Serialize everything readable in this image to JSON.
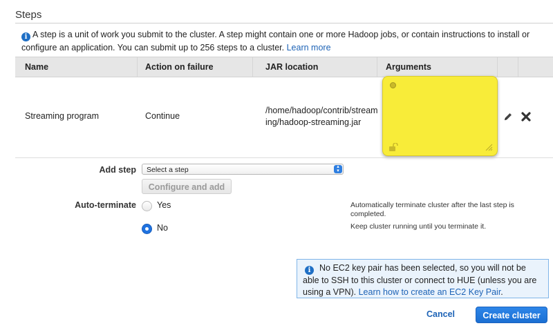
{
  "section": {
    "title": "Steps",
    "intro": "A step is a unit of work you submit to the cluster. A step might contain one or more Hadoop jobs, or contain instructions to install or configure an application. You can submit up to 256 steps to a cluster.",
    "learn_more": "Learn more"
  },
  "table": {
    "headers": [
      "Name",
      "Action on failure",
      "JAR location",
      "Arguments"
    ],
    "rows": [
      {
        "name": "Streaming program",
        "action_on_failure": "Continue",
        "jar_location_line1": "/home/hadoop/contrib/stream",
        "jar_location_line2": "ing/hadoop-streaming.jar"
      }
    ]
  },
  "form": {
    "add_step_label": "Add step",
    "select_value": "Select a step",
    "configure_button": "Configure and add",
    "auto_terminate_label": "Auto-terminate",
    "options": [
      {
        "label": "Yes",
        "selected": false,
        "help_line1": "Automatically terminate cluster after the last step is",
        "help_line2": "completed."
      },
      {
        "label": "No",
        "selected": true,
        "help_line1": "Keep cluster running until you terminate it.",
        "help_line2": ""
      }
    ]
  },
  "alert": {
    "message": "No EC2 key pair has been selected, so you will not be able to SSH to this cluster or connect to HUE (unless you are using a VPN).",
    "link": "Learn how to create an EC2 Key Pair"
  },
  "footer": {
    "cancel": "Cancel",
    "create": "Create cluster"
  },
  "icons": {
    "info": "info-icon",
    "edit": "pencil-icon",
    "delete": "close-icon"
  },
  "colors": {
    "primary": "#1b6fd3",
    "link": "#1d63b6",
    "sticky_note": "#f8ec39"
  }
}
